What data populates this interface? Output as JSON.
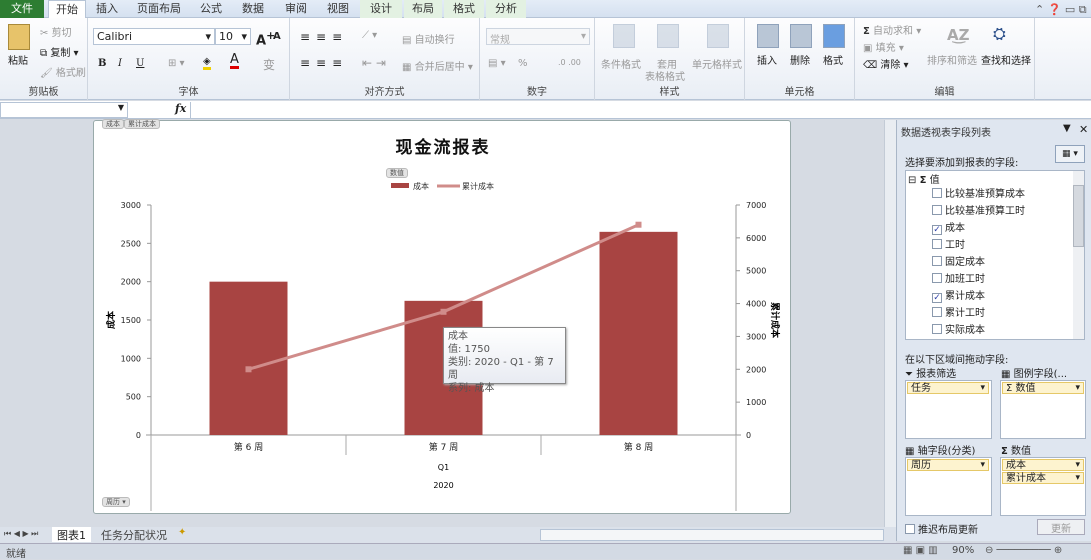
{
  "tabs": [
    "文件",
    "开始",
    "插入",
    "页面布局",
    "公式",
    "数据",
    "审阅",
    "视图",
    "设计",
    "布局",
    "格式",
    "分析"
  ],
  "ribbon": {
    "clipboard": {
      "paste": "粘贴",
      "cut": "剪切",
      "copy": "复制",
      "format_painter": "格式刷",
      "label": "剪贴板"
    },
    "font": {
      "name": "Calibri",
      "size": "10",
      "label": "字体",
      "bold": "B",
      "italic": "I",
      "underline": "U"
    },
    "align": {
      "wrap": "自动换行",
      "merge": "合并后居中",
      "label": "对齐方式"
    },
    "number": {
      "format": "常规",
      "percent": "%",
      "label": "数字"
    },
    "styles": {
      "conditional": "条件格式",
      "table": "套用",
      "table2": "表格格式",
      "cell": "单元格样式",
      "label": "样式"
    },
    "cells": {
      "insert": "插入",
      "delete": "删除",
      "format": "格式",
      "label": "单元格"
    },
    "editing": {
      "autosum": "自动求和",
      "fill": "填充",
      "clear": "清除",
      "sort": "排序和筛选",
      "find": "查找和选择",
      "label": "编辑"
    }
  },
  "formula_bar": {
    "fx": "fx",
    "value": ""
  },
  "chart_buttons": {
    "top1": "成本",
    "top2": "累计成本",
    "values": "数值",
    "axis": "周历"
  },
  "chart_data": {
    "type": "bar+line",
    "title": "现金流报表",
    "categories": [
      "第 6 周",
      "第 7 周",
      "第 8 周"
    ],
    "group_labels": [
      "Q1",
      "2020"
    ],
    "series": [
      {
        "name": "成本",
        "type": "bar",
        "axis": "left",
        "values": [
          2000,
          1750,
          2650
        ],
        "color": "#a84442"
      },
      {
        "name": "累计成本",
        "type": "line",
        "axis": "right",
        "values": [
          2000,
          3750,
          6400
        ],
        "color": "#d08c8a"
      }
    ],
    "ylabel": "成本",
    "y2label": "累计成本",
    "ylim": [
      0,
      3000
    ],
    "yticks": [
      "0",
      "500",
      "1000",
      "1500",
      "2000",
      "2500",
      "3000"
    ],
    "y2lim": [
      0,
      7000
    ],
    "y2ticks": [
      "0",
      "1000",
      "2000",
      "3000",
      "4000",
      "5000",
      "6000",
      "7000"
    ],
    "legend": "top-center"
  },
  "tooltip": [
    "成本",
    "值: 1750",
    "类别: 2020 - Q1 - 第 7 周",
    "系列: 成本"
  ],
  "panel": {
    "title": "数据透视表字段列表",
    "choose": "选择要添加到报表的字段:",
    "root": "值",
    "fields": [
      {
        "label": "比较基准预算成本",
        "checked": false
      },
      {
        "label": "比较基准预算工时",
        "checked": false
      },
      {
        "label": "成本",
        "checked": true
      },
      {
        "label": "工时",
        "checked": false
      },
      {
        "label": "固定成本",
        "checked": false
      },
      {
        "label": "加班工时",
        "checked": false
      },
      {
        "label": "累计成本",
        "checked": true
      },
      {
        "label": "累计工时",
        "checked": false
      },
      {
        "label": "实际成本",
        "checked": false
      }
    ],
    "drag": "在以下区域间拖动字段:",
    "filter_label": "报表筛选",
    "filter_item": "任务",
    "legend_label": "图例字段(...",
    "legend_item": "Σ 数值",
    "axis_label": "轴字段(分类)",
    "axis_item": "周历",
    "values_label": "数值",
    "values_items": [
      "成本",
      "累计成本"
    ],
    "defer": "推迟布局更新",
    "update": "更新"
  },
  "sheet_tabs": [
    "图表1",
    "任务分配状况"
  ],
  "status": {
    "ready": "就绪",
    "zoom": "90%"
  }
}
